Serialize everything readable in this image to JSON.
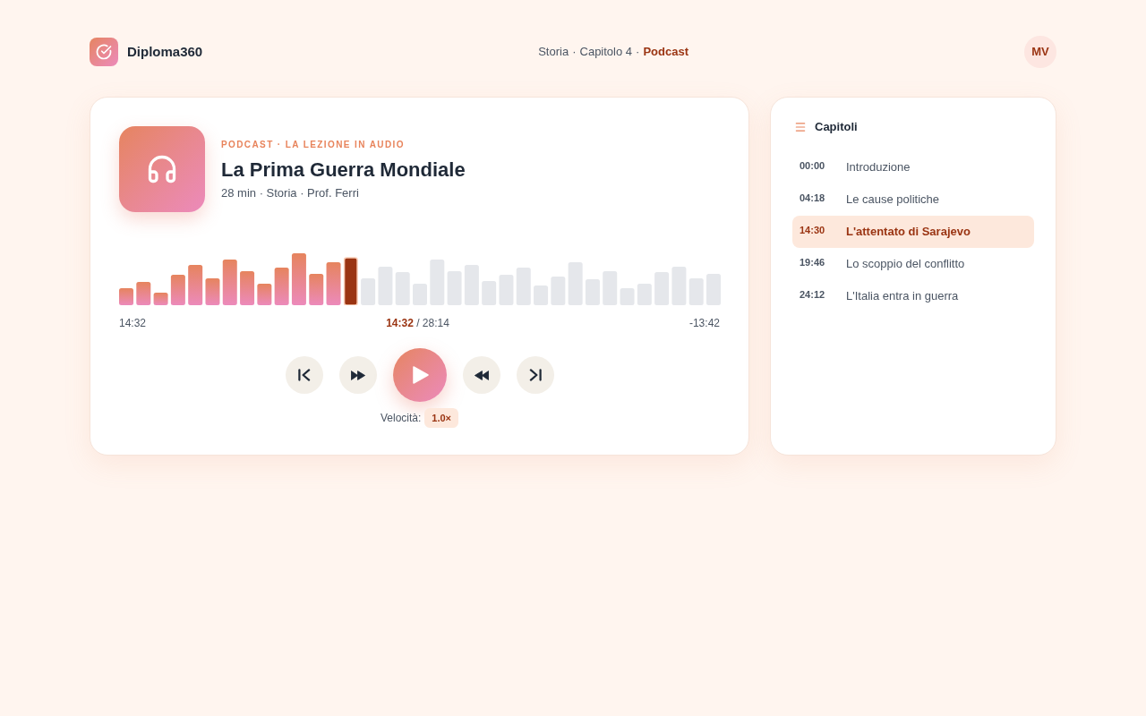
{
  "header": {
    "brand": "Diploma360",
    "breadcrumb": [
      {
        "label": "Storia",
        "current": false
      },
      {
        "label": "Capitolo 4",
        "current": false
      },
      {
        "label": "Podcast",
        "current": true
      }
    ],
    "separator": "·",
    "avatar": "MV"
  },
  "episode": {
    "kicker": "PODCAST · LA LEZIONE IN AUDIO",
    "title": "La Prima Guerra Mondiale",
    "meta": "28 min · Storia · Prof. Ferri"
  },
  "player": {
    "level": 0.4,
    "elapsed": "14:32",
    "position": "**14:32** / 28:14",
    "remaining": "-13:42",
    "controls": [
      {
        "kind": "previous"
      },
      {
        "kind": "forward"
      },
      {
        "kind": "play"
      },
      {
        "kind": "rewind"
      },
      {
        "kind": "next"
      }
    ],
    "speed_label": "Velocità:",
    "speed": "1.0×"
  },
  "chapters": {
    "title": "Capitoli",
    "items": [
      {
        "time": "00:00",
        "title": "Introduzione",
        "selected": false
      },
      {
        "time": "04:18",
        "title": "Le cause politiche",
        "selected": false
      },
      {
        "time": "14:30",
        "title": "L'attentato di Sarajevo",
        "selected": true
      },
      {
        "time": "19:46",
        "title": "Lo scoppio del conflitto",
        "selected": false
      },
      {
        "time": "24:12",
        "title": "L'Italia entra in guerra",
        "selected": false
      }
    ]
  }
}
